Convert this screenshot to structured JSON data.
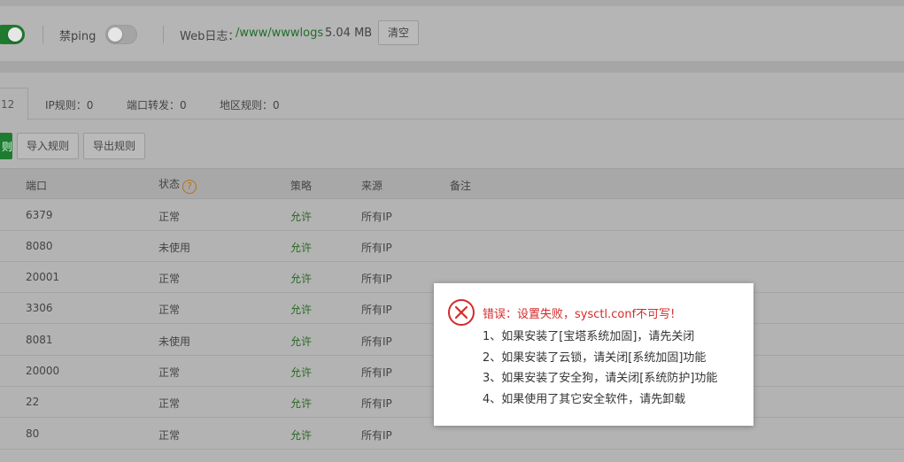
{
  "toolbar": {
    "ping_label": "禁ping",
    "weblog_label": "Web日志：",
    "weblog_path": "/www/wwwlogs",
    "weblog_size": "5.04 MB",
    "clear_button": "清空"
  },
  "tabs": [
    {
      "label": "12",
      "active": true
    },
    {
      "label": "IP规则：0"
    },
    {
      "label": "端口转发：0"
    },
    {
      "label": "地区规则：0"
    }
  ],
  "actions": {
    "add_fragment": "则",
    "import_button": "导入规则",
    "export_button": "导出规则"
  },
  "table": {
    "headers": {
      "port": "端口",
      "status": "状态",
      "help": "?",
      "policy": "策略",
      "source": "来源",
      "note": "备注"
    },
    "rows": [
      {
        "port": "6379",
        "status": "正常",
        "policy": "允许",
        "source": "所有IP"
      },
      {
        "port": "8080",
        "status": "未使用",
        "policy": "允许",
        "source": "所有IP"
      },
      {
        "port": "20001",
        "status": "正常",
        "policy": "允许",
        "source": "所有IP"
      },
      {
        "port": "3306",
        "status": "正常",
        "policy": "允许",
        "source": "所有IP"
      },
      {
        "port": "8081",
        "status": "未使用",
        "policy": "允许",
        "source": "所有IP"
      },
      {
        "port": "20000",
        "status": "正常",
        "policy": "允许",
        "source": "所有IP"
      },
      {
        "port": "22",
        "status": "正常",
        "policy": "允许",
        "source": "所有IP"
      },
      {
        "port": "80",
        "status": "正常",
        "policy": "允许",
        "source": "所有IP"
      }
    ]
  },
  "dialog": {
    "title": "错误：设置失败，sysctl.conf不可写!",
    "lines": [
      "1、如果安装了[宝塔系统加固]，请先关闭",
      "2、如果安装了云锁，请关闭[系统加固]功能",
      "3、如果安装了安全狗，请关闭[系统防护]功能",
      "4、如果使用了其它安全软件，请先卸载"
    ]
  },
  "colors": {
    "accent_green": "#20a53a",
    "error_red": "#d42a2a",
    "overlay": "#b3b3b3"
  }
}
